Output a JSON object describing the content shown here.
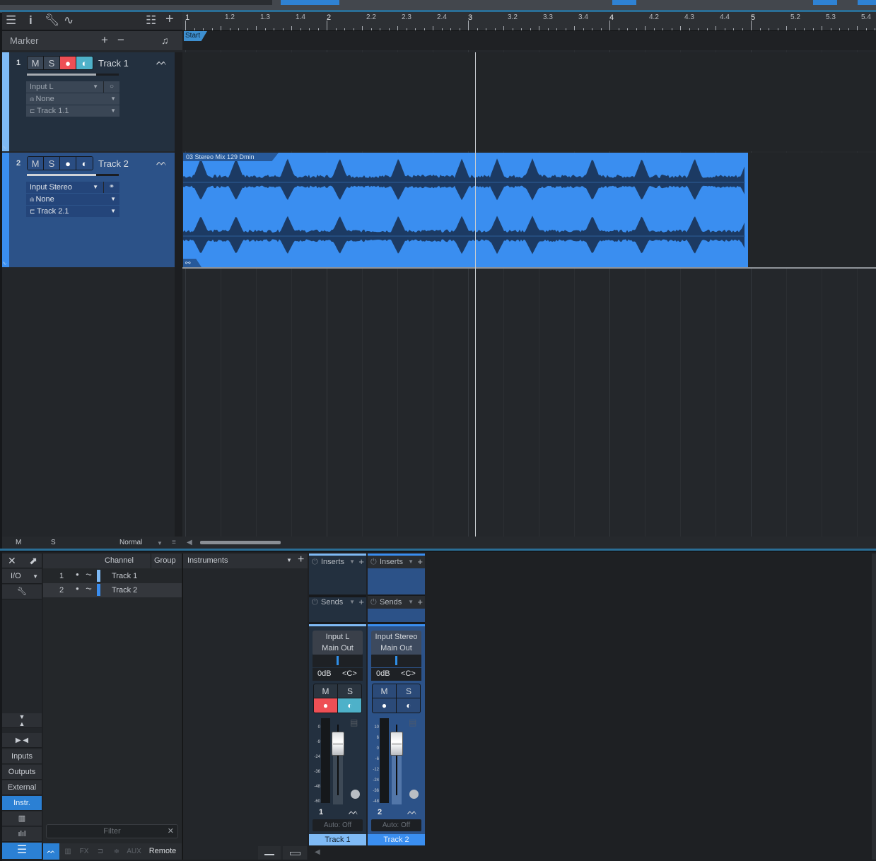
{
  "toolbar": {
    "icons": [
      "menu-icon",
      "info-icon",
      "wrench-icon",
      "automation-curve-icon",
      "track-list-icon",
      "add-track-icon"
    ]
  },
  "marker": {
    "label": "Marker",
    "add": "+",
    "remove": "−"
  },
  "ruler": {
    "labels": [
      "1",
      "1.2",
      "1.3",
      "1.4",
      "2",
      "2.2",
      "2.3",
      "2.4",
      "3",
      "3.2",
      "3.3",
      "3.4",
      "4",
      "4.2",
      "4.3",
      "4.4",
      "5",
      "5.2",
      "5.3",
      "5.4"
    ],
    "start_marker": "Start"
  },
  "tracks": [
    {
      "number": "1",
      "mute": "M",
      "solo": "S",
      "name": "Track 1",
      "record_armed": true,
      "monitor_on": true,
      "input": "Input L",
      "instrument": "None",
      "output": "Track 1.1",
      "color": "#7fbaf5"
    },
    {
      "number": "2",
      "mute": "M",
      "solo": "S",
      "name": "Track 2",
      "record_armed": false,
      "monitor_on": false,
      "input": "Input Stereo",
      "instrument": "None",
      "output": "Track 2.1",
      "color": "#3a8ef0"
    }
  ],
  "clip": {
    "name": "03 Stereo Mix 129 Dmin",
    "link_icon": "⚯"
  },
  "arrange_bottom": {
    "m": "M",
    "s": "S",
    "mode": "Normal"
  },
  "mixer": {
    "side": {
      "close": "✕",
      "io": "I/O",
      "buttons": [
        "Inputs",
        "Outputs",
        "External",
        "Instr."
      ],
      "active": "Instr."
    },
    "channel_list": {
      "headers": {
        "channel": "Channel",
        "group": "Group"
      },
      "rows": [
        {
          "num": "1",
          "name": "Track 1",
          "color": "#7fbaf5"
        },
        {
          "num": "2",
          "name": "Track 2",
          "color": "#3a8ef0"
        }
      ],
      "filter_placeholder": "Filter",
      "filter_tabs": [
        "AUX",
        "Remote"
      ]
    },
    "instruments": {
      "title": "Instruments"
    },
    "strips": [
      {
        "inserts": "Inserts",
        "sends": "Sends",
        "input": "Input L",
        "output": "Main Out",
        "volume": "0dB",
        "pan": "<C>",
        "mute": "M",
        "solo": "S",
        "number": "1",
        "automation": "Auto: Off",
        "name": "Track 1",
        "scale": [
          "0",
          "-9",
          "-24",
          "-36",
          "-48",
          "-60"
        ]
      },
      {
        "inserts": "Inserts",
        "sends": "Sends",
        "input": "Input Stereo",
        "output": "Main Out",
        "volume": "0dB",
        "pan": "<C>",
        "mute": "M",
        "solo": "S",
        "number": "2",
        "automation": "Auto: Off",
        "name": "Track 2",
        "scale": [
          "10",
          "6",
          "0",
          "-6",
          "-12",
          "-24",
          "-36",
          "-48"
        ]
      }
    ]
  }
}
